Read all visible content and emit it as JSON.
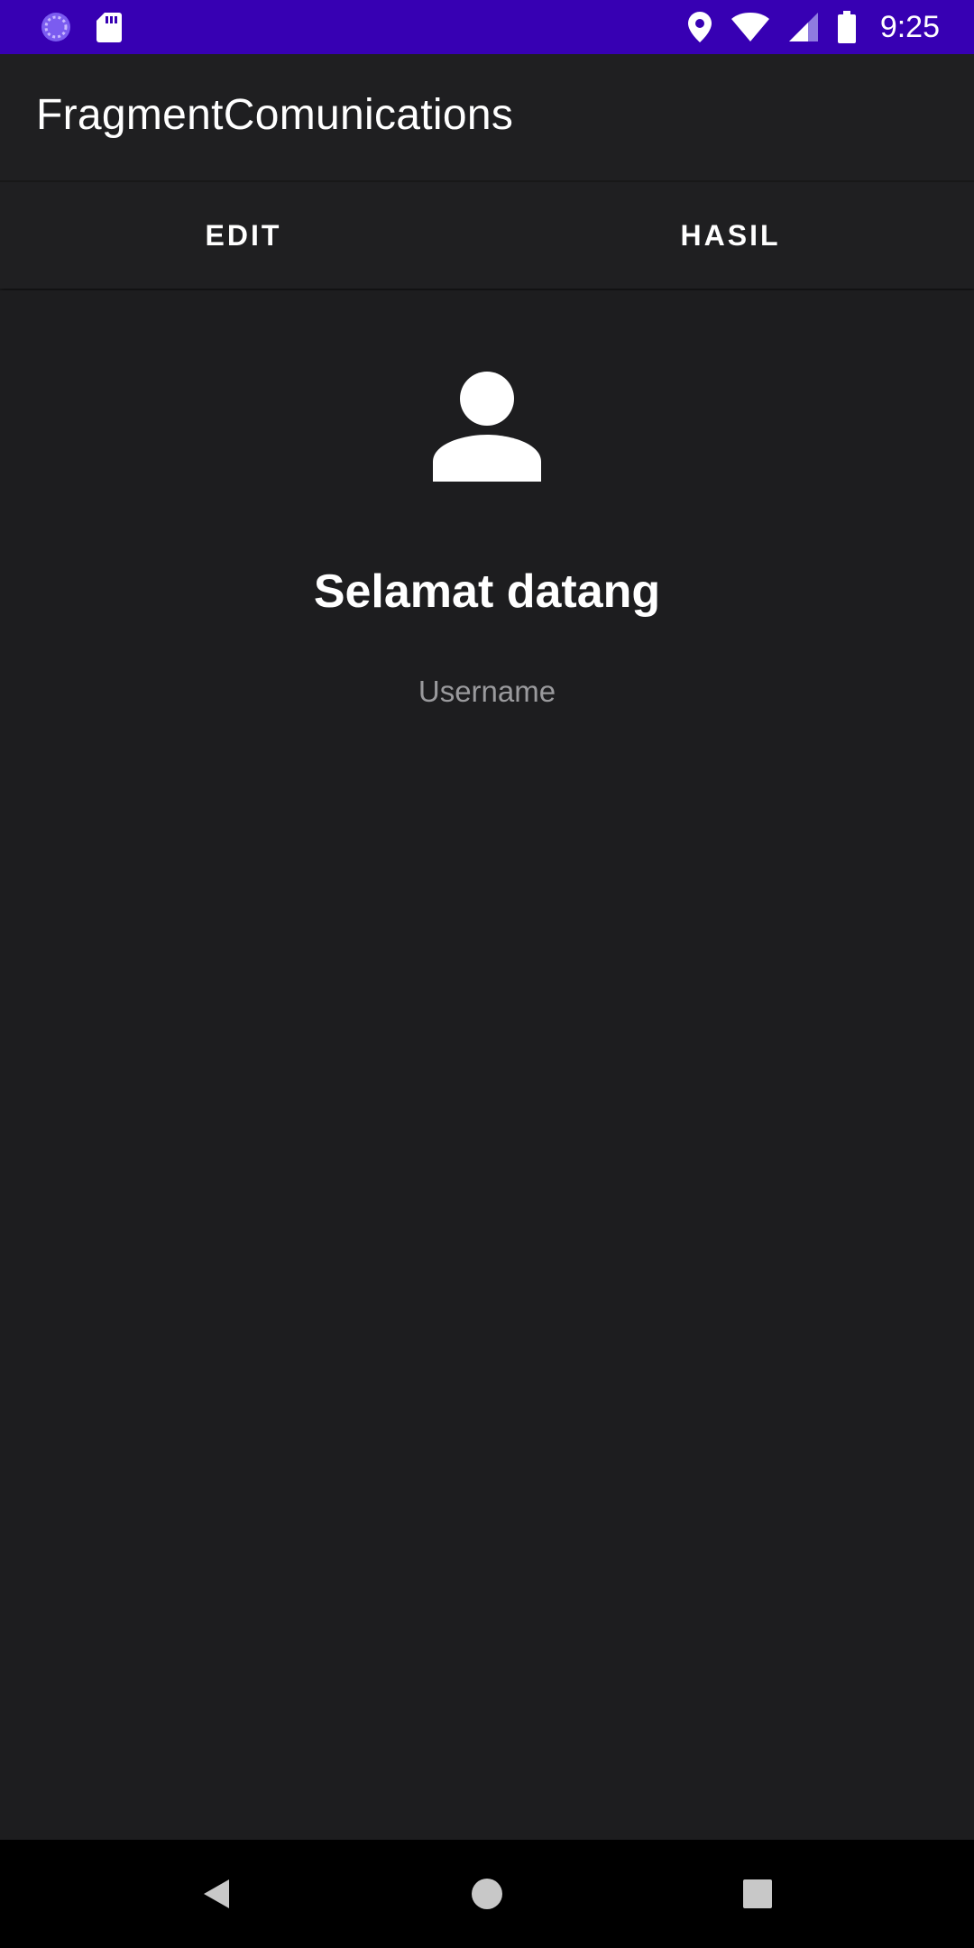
{
  "status_bar": {
    "time": "9:25",
    "left_icons": [
      "sync-circle-icon",
      "sd-card-icon"
    ],
    "right_icons": [
      "location-icon",
      "wifi-icon",
      "cell-signal-icon",
      "battery-icon"
    ],
    "background": "#3700b3"
  },
  "app_bar": {
    "title": "FragmentComunications"
  },
  "tabs": [
    {
      "label": "EDIT"
    },
    {
      "label": "HASIL"
    }
  ],
  "main": {
    "avatar_icon": "person-icon",
    "welcome_text": "Selamat datang",
    "username_text": "Username"
  },
  "nav_bar": {
    "buttons": [
      "back-icon",
      "home-icon",
      "recents-icon"
    ]
  },
  "colors": {
    "background": "#1d1d1f",
    "text_primary": "#ffffff",
    "text_secondary": "#9a9a9d"
  }
}
